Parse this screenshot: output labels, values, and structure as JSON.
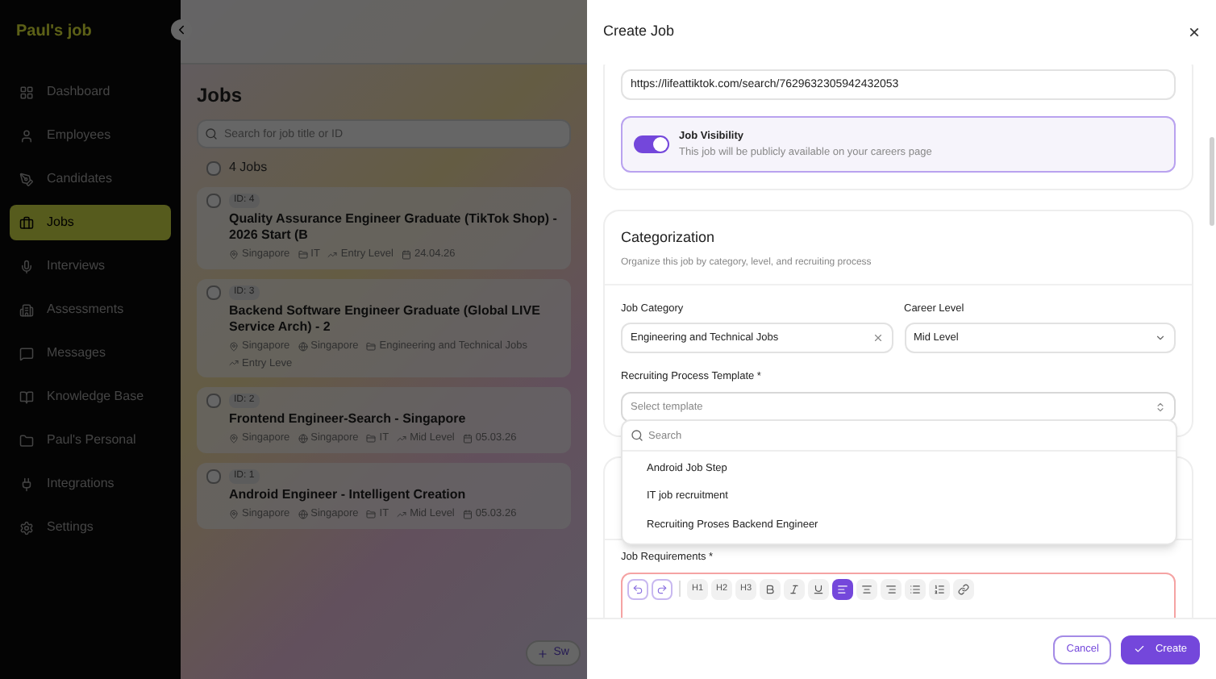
{
  "sidebar": {
    "brand": "Paul's job",
    "items": [
      {
        "label": "Dashboard",
        "selected": false
      },
      {
        "label": "Employees",
        "selected": false
      },
      {
        "label": "Candidates",
        "selected": false
      },
      {
        "label": "Jobs",
        "selected": true
      },
      {
        "label": "Interviews",
        "selected": false
      },
      {
        "label": "Assessments",
        "selected": false
      },
      {
        "label": "Messages",
        "selected": false
      },
      {
        "label": "Knowledge Base",
        "selected": false
      },
      {
        "label": "Paul's Personal",
        "selected": false
      },
      {
        "label": "Integrations",
        "selected": false
      },
      {
        "label": "Settings",
        "selected": false
      }
    ]
  },
  "main": {
    "title": "Jobs",
    "search": {
      "placeholder": "Search for job title or ID"
    },
    "count": "4 Jobs",
    "all_checked": false,
    "jobs": [
      {
        "checked": false,
        "id": "ID: 4",
        "title": "Quality Assurance Engineer Graduate (TikTok Shop) - 2026 Start (B",
        "meta": [
          {
            "kind": "location",
            "text": "Singapore"
          },
          {
            "kind": "category",
            "text": "IT"
          },
          {
            "kind": "level",
            "text": "Entry Level"
          },
          {
            "kind": "date",
            "text": "24.04.26"
          }
        ]
      },
      {
        "checked": false,
        "id": "ID: 3",
        "title": "Backend Software Engineer Graduate (Global LIVE Service Arch) - 2",
        "meta": [
          {
            "kind": "location",
            "text": "Singapore"
          },
          {
            "kind": "office",
            "text": "Singapore"
          },
          {
            "kind": "category",
            "text": "Engineering and Technical Jobs"
          },
          {
            "kind": "level",
            "text": "Entry Leve"
          }
        ]
      },
      {
        "checked": false,
        "id": "ID: 2",
        "title": "Frontend Engineer-Search - Singapore",
        "meta": [
          {
            "kind": "location",
            "text": "Singapore"
          },
          {
            "kind": "office",
            "text": "Singapore"
          },
          {
            "kind": "category",
            "text": "IT"
          },
          {
            "kind": "level",
            "text": "Mid Level"
          },
          {
            "kind": "date",
            "text": "05.03.26"
          }
        ]
      },
      {
        "checked": false,
        "id": "ID: 1",
        "title": "Android Engineer - Intelligent Creation",
        "meta": [
          {
            "kind": "location",
            "text": "Singapore"
          },
          {
            "kind": "office",
            "text": "Singapore"
          },
          {
            "kind": "category",
            "text": "IT"
          },
          {
            "kind": "level",
            "text": "Mid Level"
          },
          {
            "kind": "date",
            "text": "05.03.26"
          }
        ]
      }
    ],
    "floating_button": "Sw"
  },
  "drawer": {
    "title": "Create Job",
    "close": "×",
    "url": "https://lifeattiktok.com/search/7629632305942432053",
    "visibility": {
      "label": "Job Visibility",
      "description": "This job will be publicly available on your careers page",
      "on": true
    },
    "categorization": {
      "title": "Categorization",
      "subtitle": "Organize this job by category, level, and recruiting process",
      "job_category": {
        "label": "Job Category",
        "value": "Engineering and Technical Jobs"
      },
      "career_level": {
        "label": "Career Level",
        "value": "Mid Level"
      },
      "template": {
        "label": "Recruiting Process Template *",
        "placeholder": "Select template",
        "expanded": true,
        "search_placeholder": "Search",
        "options": [
          "Android Job Step",
          "IT job recruitment",
          "Recruiting Proses Backend Engineer"
        ]
      }
    },
    "requirements": {
      "label": "Job Requirements *",
      "toolbar": [
        {
          "kind": "undo",
          "active": false
        },
        {
          "kind": "redo",
          "active": false
        },
        {
          "kind": "h1",
          "label": "H1",
          "active": false
        },
        {
          "kind": "h2",
          "label": "H2",
          "active": false
        },
        {
          "kind": "h3",
          "label": "H3",
          "active": false
        },
        {
          "kind": "bold",
          "active": false
        },
        {
          "kind": "italic",
          "active": false
        },
        {
          "kind": "underline",
          "active": false
        },
        {
          "kind": "align-left",
          "active": true
        },
        {
          "kind": "align-center",
          "active": false
        },
        {
          "kind": "align-right",
          "active": false
        },
        {
          "kind": "bullets",
          "active": false
        },
        {
          "kind": "numbers",
          "active": false
        },
        {
          "kind": "link",
          "active": false
        }
      ]
    },
    "buttons": {
      "cancel": "Cancel",
      "create": "Create"
    }
  }
}
